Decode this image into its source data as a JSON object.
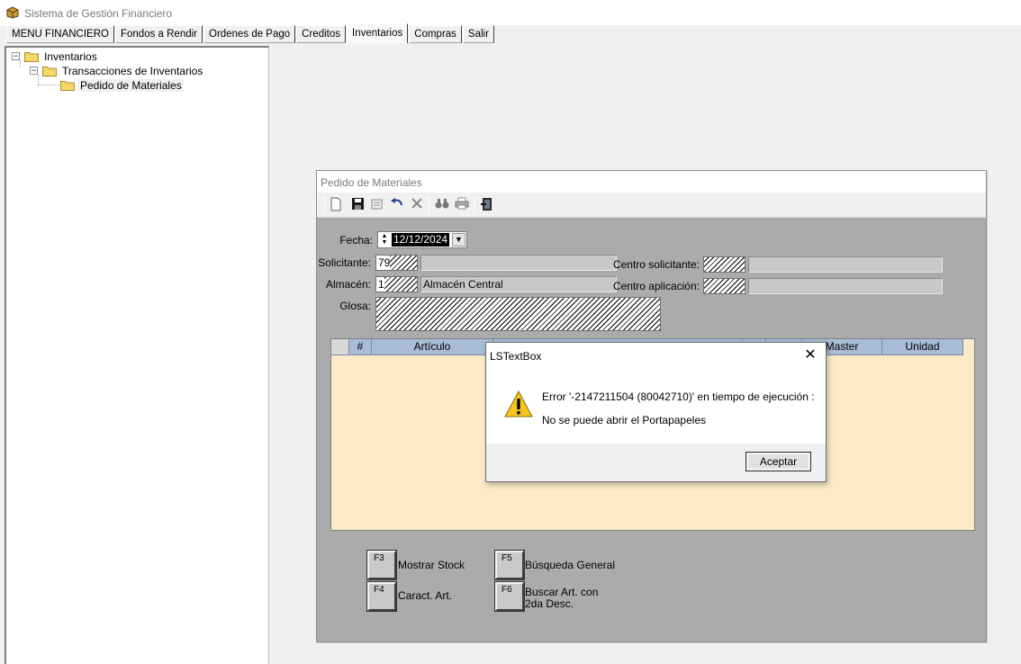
{
  "app": {
    "title": "Sistema de Gestión Financiero"
  },
  "tabs": [
    {
      "label": "MENU FINANCIERO"
    },
    {
      "label": "Fondos a Rendir"
    },
    {
      "label": "Ordenes de Pago"
    },
    {
      "label": "Creditos"
    },
    {
      "label": "Inventarios",
      "active": true
    },
    {
      "label": "Compras"
    },
    {
      "label": "Salir"
    }
  ],
  "tree": {
    "root": "Inventarios",
    "child": "Transacciones de Inventarios",
    "leaf": "Pedido de Materiales",
    "expanders": [
      "−",
      "−"
    ]
  },
  "form": {
    "title": "Pedido de Materiales",
    "fecha_label": "Fecha:",
    "fecha_value": "12/12/2024",
    "solicitante_label": "Solicitante:",
    "solicitante_code": "79",
    "solicitante_name": "",
    "almacen_label": "Almacén:",
    "almacen_code": "1",
    "almacen_name": "Almacén Central",
    "centro_solicitante_label": "Centro solicitante:",
    "centro_aplicacion_label": "Centro aplicación:",
    "glosa_label": "Glosa:",
    "grid_columns": [
      "#",
      "Artículo",
      "Master",
      "Unidad"
    ]
  },
  "fkeys": [
    {
      "key": "F3",
      "label": "Mostrar Stock"
    },
    {
      "key": "F4",
      "label": "Caract. Art."
    },
    {
      "key": "F5",
      "label": "Búsqueda General"
    },
    {
      "key": "F6",
      "label": "Buscar Art. con\n2da Desc."
    }
  ],
  "dialog": {
    "title": "LSTextBox",
    "message1": "Error '-2147211504 (80042710)' en tiempo de ejecución :",
    "message2": "No se puede abrir el Portapapeles",
    "ok_label": "Aceptar",
    "close_glyph": "✕"
  },
  "icons": {
    "new": "new-document-icon",
    "save": "save-icon",
    "edit": "edit-icon",
    "undo": "undo-icon",
    "delete": "delete-icon",
    "find": "binoculars-icon",
    "print": "print-icon",
    "exit": "exit-door-icon"
  }
}
